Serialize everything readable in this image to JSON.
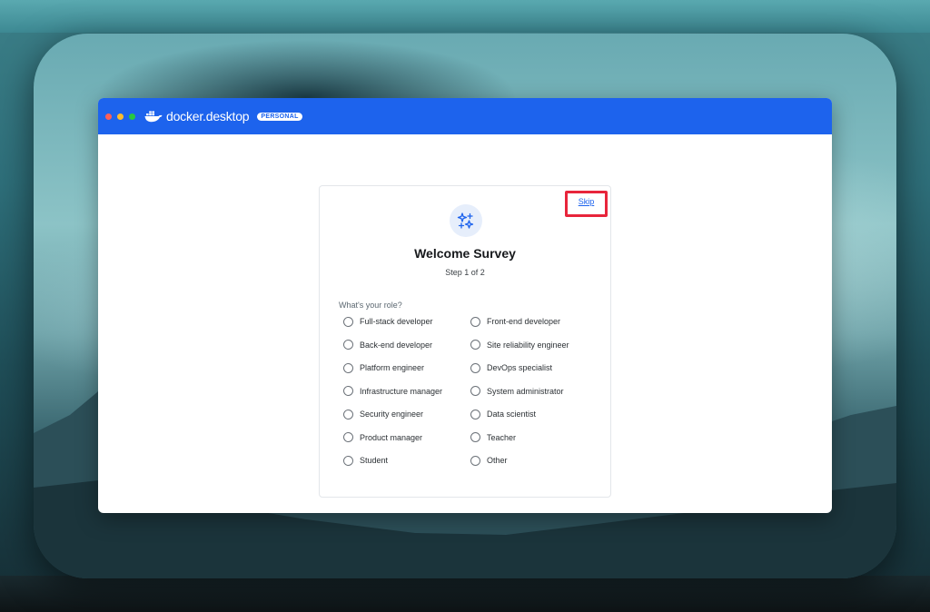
{
  "app": {
    "name": "docker.desktop",
    "badge": "PERSONAL",
    "accent": "#1d63ed"
  },
  "survey": {
    "skip_label": "Skip",
    "title": "Welcome Survey",
    "step": "Step 1 of 2",
    "question": "What's your role?",
    "icon": "sparkles-icon",
    "options": [
      "Full-stack developer",
      "Front-end developer",
      "Back-end developer",
      "Site reliability engineer",
      "Platform engineer",
      "DevOps specialist",
      "Infrastructure manager",
      "System administrator",
      "Security engineer",
      "Data scientist",
      "Product manager",
      "Teacher",
      "Student",
      "Other"
    ]
  },
  "highlight_color": "#e8253b"
}
